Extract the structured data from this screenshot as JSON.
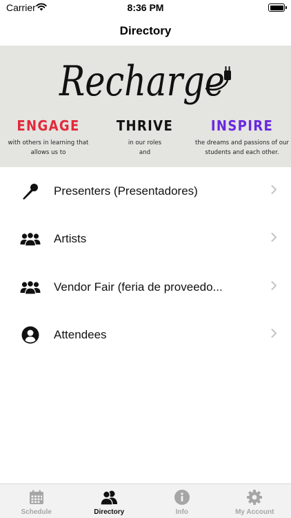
{
  "status": {
    "carrier": "Carrier",
    "time": "8:36 PM"
  },
  "nav": {
    "title": "Directory"
  },
  "banner": {
    "brand_word": "Recharge",
    "pillars": [
      {
        "title": "ENGAGE",
        "desc_line1": "with others in learning that",
        "desc_line2": "allows us to",
        "color": "#e12a3b"
      },
      {
        "title": "THRIVE",
        "desc_line1": "in our roles",
        "desc_line2": "and",
        "color": "#111111"
      },
      {
        "title": "INSPIRE",
        "desc_line1": "the dreams and passions of our",
        "desc_line2": "students and each other.",
        "color": "#6a28e0"
      }
    ]
  },
  "directory": {
    "items": [
      {
        "label": "Presenters (Presentadores)",
        "icon": "microphone-icon"
      },
      {
        "label": "Artists",
        "icon": "group-icon"
      },
      {
        "label": "Vendor Fair (feria de proveedo...",
        "icon": "group-icon"
      },
      {
        "label": "Attendees",
        "icon": "person-circle-icon"
      }
    ]
  },
  "tabs": [
    {
      "label": "Schedule",
      "icon": "calendar-icon",
      "active": false
    },
    {
      "label": "Directory",
      "icon": "people-icon",
      "active": true
    },
    {
      "label": "Info",
      "icon": "info-icon",
      "active": false
    },
    {
      "label": "My Account",
      "icon": "gear-icon",
      "active": false
    }
  ]
}
